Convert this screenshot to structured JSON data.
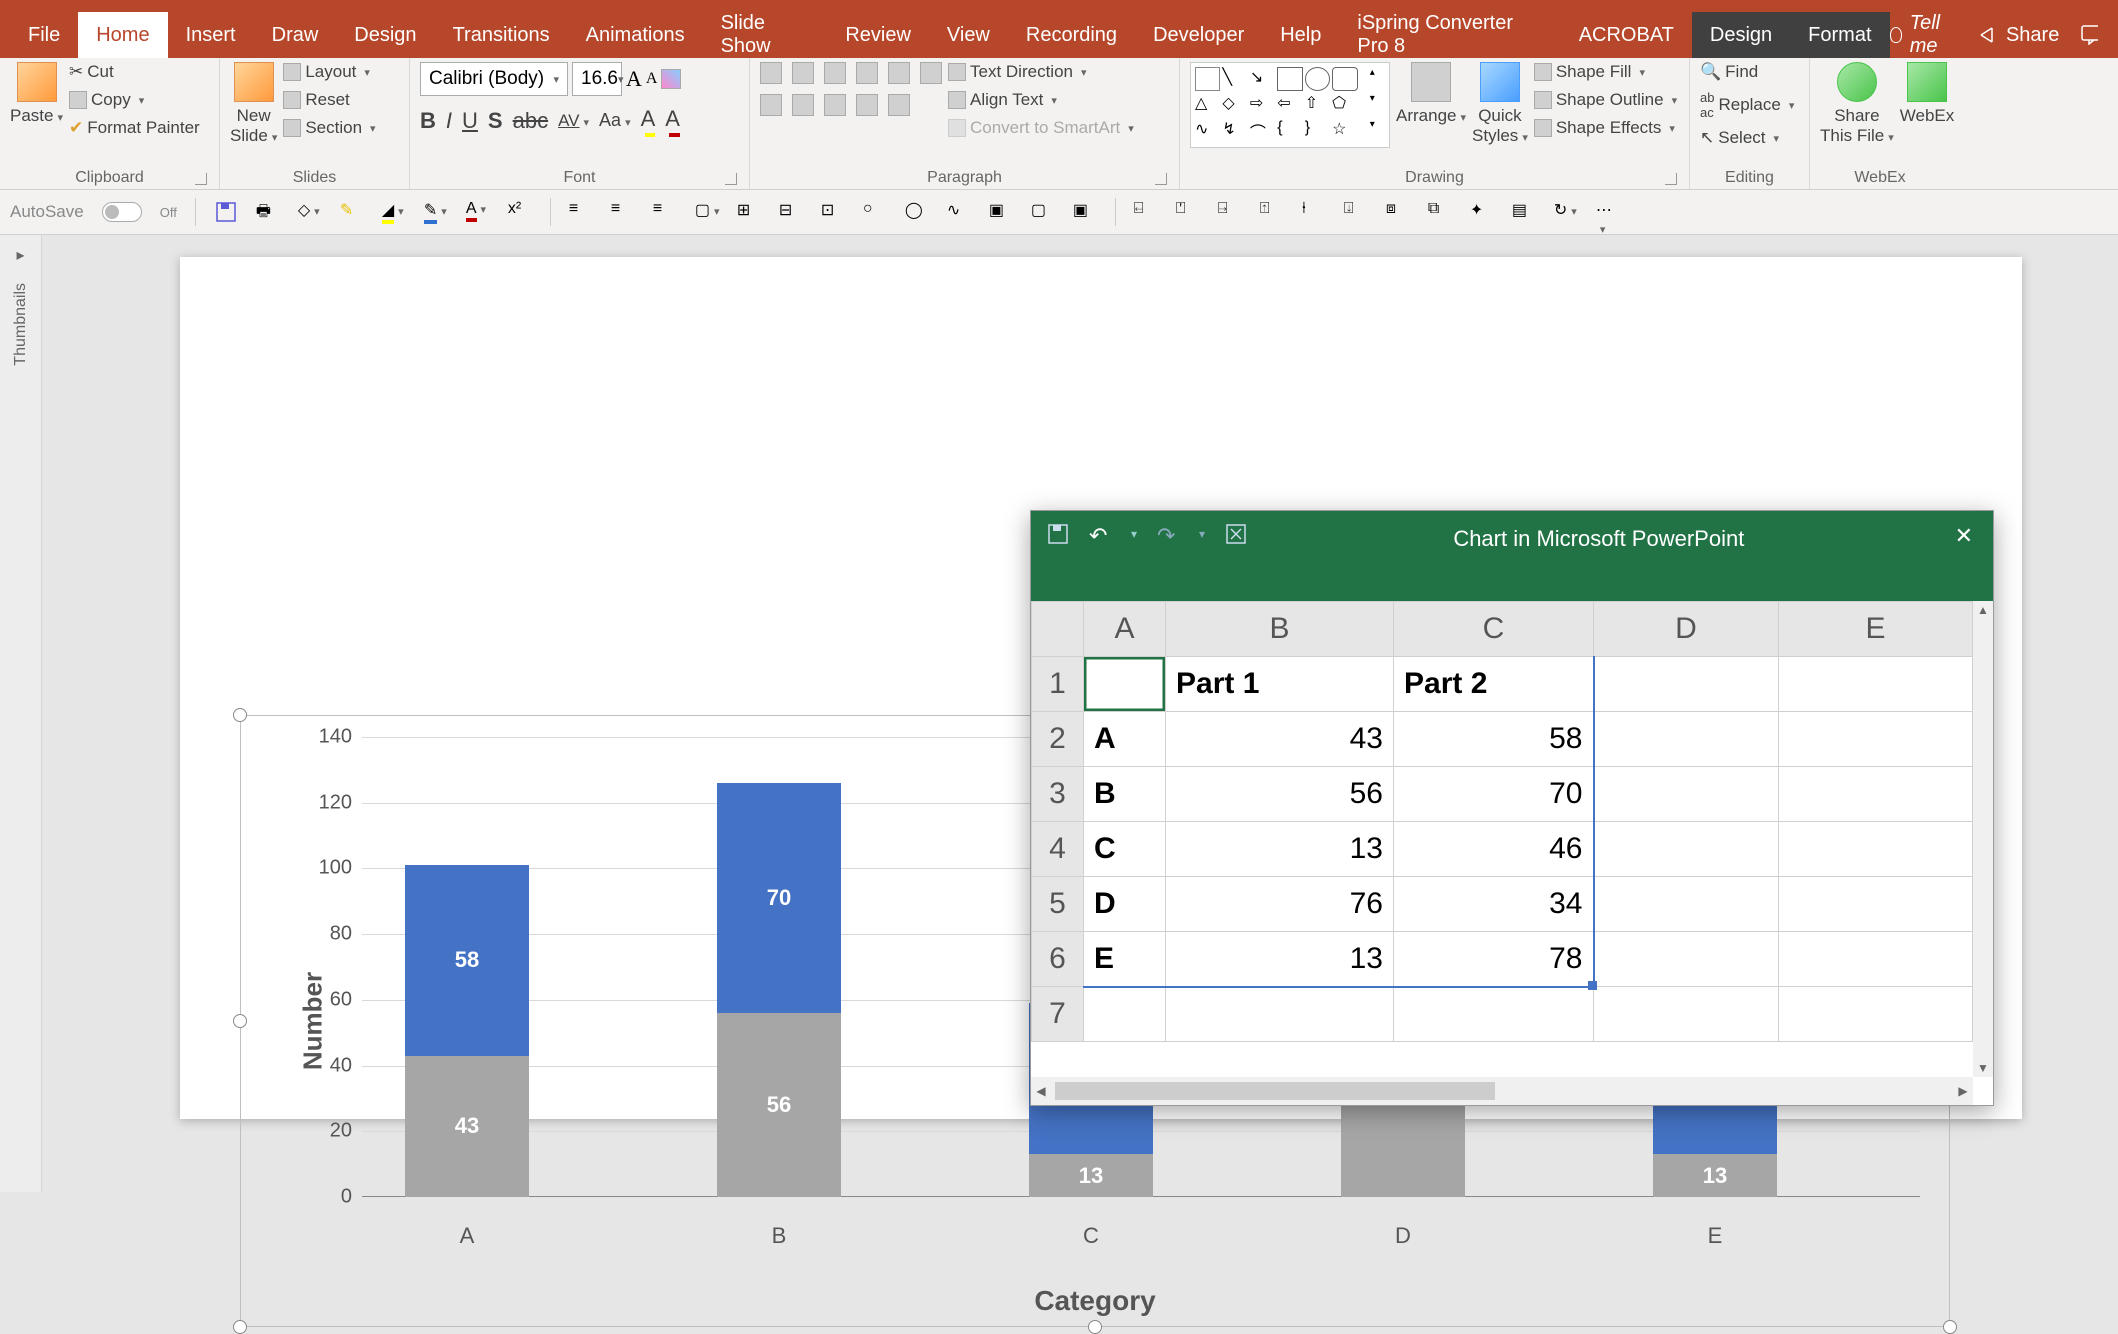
{
  "ribbon": {
    "tabs": [
      "File",
      "Home",
      "Insert",
      "Draw",
      "Design",
      "Transitions",
      "Animations",
      "Slide Show",
      "Review",
      "View",
      "Recording",
      "Developer",
      "Help",
      "iSpring Converter Pro 8",
      "ACROBAT",
      "Design",
      "Format"
    ],
    "active_tab_index": 1,
    "contextual_start_index": 15,
    "tell_me": "Tell me",
    "share": "Share"
  },
  "groups": {
    "clipboard": {
      "label": "Clipboard",
      "paste": "Paste",
      "cut": "Cut",
      "copy": "Copy",
      "format_painter": "Format Painter"
    },
    "slides": {
      "label": "Slides",
      "new_slide": "New\nSlide",
      "layout": "Layout",
      "reset": "Reset",
      "section": "Section"
    },
    "font": {
      "label": "Font",
      "font_name": "Calibri (Body)",
      "font_size": "16.6"
    },
    "paragraph": {
      "label": "Paragraph",
      "text_direction": "Text Direction",
      "align_text": "Align Text",
      "convert_smartart": "Convert to SmartArt"
    },
    "drawing": {
      "label": "Drawing",
      "arrange": "Arrange",
      "quick_styles": "Quick\nStyles",
      "shape_fill": "Shape Fill",
      "shape_outline": "Shape Outline",
      "shape_effects": "Shape Effects"
    },
    "editing": {
      "label": "Editing",
      "find": "Find",
      "replace": "Replace",
      "select": "Select"
    },
    "webex": {
      "label": "WebEx",
      "share": "Share\nThis File",
      "webex": "WebEx"
    }
  },
  "qat": {
    "autosave": "AutoSave",
    "autosave_state": "Off"
  },
  "thumbnails": {
    "label": "Thumbnails"
  },
  "chart": {
    "y_title": "Number",
    "x_title": "Category",
    "y_ticks": [
      "0",
      "20",
      "40",
      "60",
      "80",
      "100",
      "120",
      "140"
    ],
    "visible_labels": {
      "A": {
        "p1": "43",
        "p2": "58"
      },
      "B": {
        "p1": "56",
        "p2": "70"
      },
      "C": {
        "p1": "13"
      },
      "E": {
        "p1": "13"
      }
    }
  },
  "chart_data": {
    "type": "bar",
    "stacked": true,
    "categories": [
      "A",
      "B",
      "C",
      "D",
      "E"
    ],
    "series": [
      {
        "name": "Part 1",
        "values": [
          43,
          56,
          13,
          76,
          13
        ]
      },
      {
        "name": "Part 2",
        "values": [
          58,
          70,
          46,
          34,
          78
        ]
      }
    ],
    "xlabel": "Category",
    "ylabel": "Number",
    "ylim": [
      0,
      140
    ],
    "colors": {
      "Part 1": "#a6a6a6",
      "Part 2": "#4472c4"
    }
  },
  "data_window": {
    "title": "Chart in Microsoft PowerPoint",
    "col_headers": [
      "A",
      "B",
      "C",
      "D",
      "E"
    ],
    "row_headers": [
      "1",
      "2",
      "3",
      "4",
      "5",
      "6",
      "7"
    ],
    "cells": {
      "B1": "Part 1",
      "C1": "Part 2",
      "A2": "A",
      "B2": "43",
      "C2": "58",
      "A3": "B",
      "B3": "56",
      "C3": "70",
      "A4": "C",
      "B4": "13",
      "C4": "46",
      "A5": "D",
      "B5": "76",
      "C5": "34",
      "A6": "E",
      "B6": "13",
      "C6": "78"
    }
  }
}
